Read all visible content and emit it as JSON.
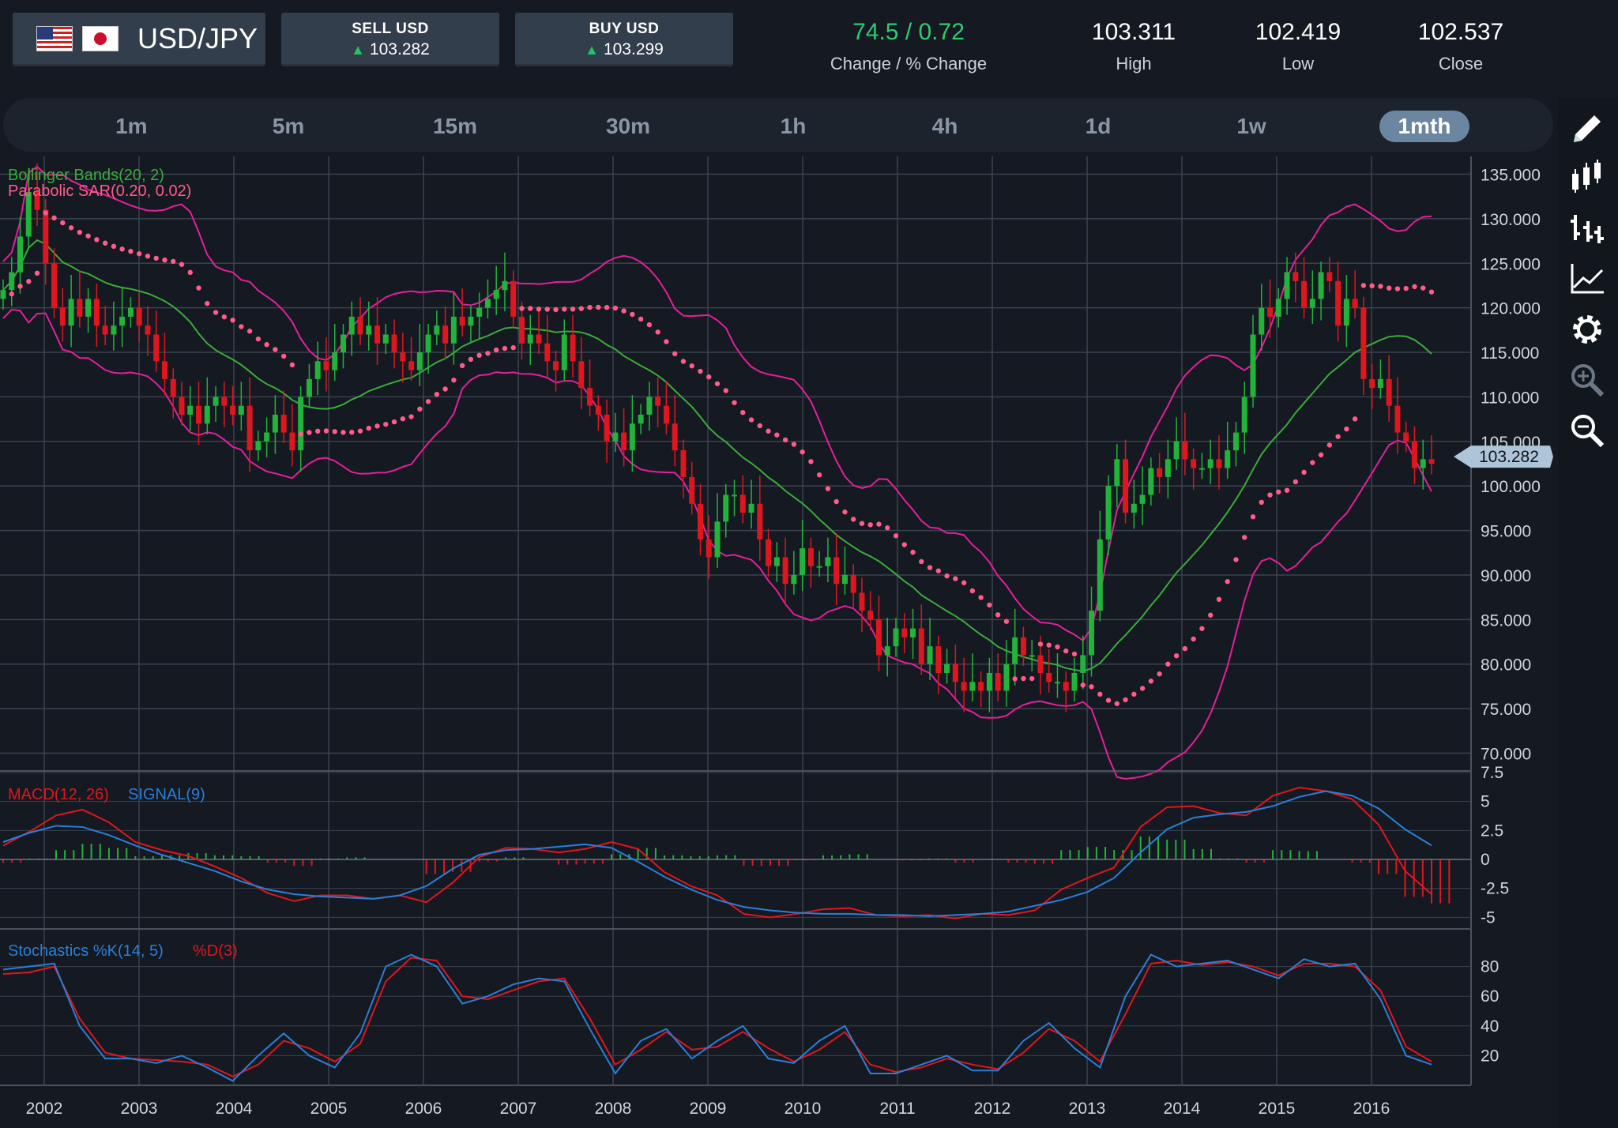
{
  "header": {
    "pair": "USD/JPY",
    "sell_title": "SELL USD",
    "sell_price": "103.282",
    "buy_title": "BUY USD",
    "buy_price": "103.299",
    "change": "74.5 / 0.72",
    "change_label": "Change / % Change",
    "high": "103.311",
    "high_label": "High",
    "low": "102.419",
    "low_label": "Low",
    "close": "102.537",
    "close_label": "Close"
  },
  "timeframes": [
    "1m",
    "5m",
    "15m",
    "30m",
    "1h",
    "4h",
    "1d",
    "1w",
    "1mth"
  ],
  "active_timeframe": "1mth",
  "toolbar_icons": [
    "pencil-icon",
    "candlestick-icon",
    "bars-icon",
    "line-chart-icon",
    "gear-icon",
    "zoom-in-icon",
    "zoom-out-icon"
  ],
  "colors": {
    "bull": "#22b33a",
    "bear": "#e0161e",
    "bollinger_band": "#e51f9c",
    "bollinger_mid": "#3bab3b",
    "sar": "#ff5c8a",
    "macd": "#e0161e",
    "signal": "#2a7fd8",
    "k": "#2a7fd8",
    "d": "#e0161e",
    "price_tag": "#aec4d8",
    "grid": "#3a4350"
  },
  "chart_data": {
    "type": "candlestick",
    "main": {
      "indicator1": "Bollinger Bands(20, 2)",
      "indicator2": "Parabolic SAR(0.20, 0.02)",
      "y_ticks": [
        "135.000",
        "130.000",
        "125.000",
        "120.000",
        "115.000",
        "110.000",
        "105.000",
        "100.000",
        "95.000",
        "90.000",
        "85.000",
        "80.000",
        "75.000",
        "70.000"
      ],
      "ylim": [
        68,
        137
      ],
      "last_price": "103.282",
      "close": [
        122,
        124,
        128,
        133,
        131,
        125,
        120,
        118,
        121,
        119,
        121,
        118,
        117,
        118,
        119,
        120,
        118,
        117,
        114,
        112,
        110,
        108,
        109,
        107,
        109,
        110,
        109,
        108,
        109,
        104,
        105,
        106,
        108,
        106,
        104,
        110,
        112,
        114,
        113,
        115,
        117,
        119,
        117,
        118,
        116,
        117,
        115,
        114,
        113,
        115,
        117,
        118,
        116,
        119,
        118,
        119,
        120,
        121,
        122,
        123,
        119,
        116,
        117,
        116,
        114,
        113,
        117,
        114,
        111,
        109,
        108,
        105,
        106,
        104,
        107,
        108,
        110,
        109,
        107,
        104,
        101,
        98,
        94,
        92,
        96,
        99,
        99,
        97,
        98,
        94,
        91,
        92,
        89,
        90,
        93,
        91,
        91,
        92,
        89,
        90,
        88,
        86,
        85,
        81,
        82,
        84,
        83,
        84,
        80,
        82,
        79,
        80,
        78,
        77,
        78,
        77,
        79,
        77,
        80,
        83,
        81,
        81,
        79,
        78,
        78,
        77,
        79,
        81,
        86,
        94,
        100,
        103,
        97,
        98,
        99,
        102,
        101,
        103,
        105,
        103,
        102,
        102,
        103,
        102,
        104,
        106,
        110,
        117,
        120,
        119,
        121,
        124,
        123,
        120,
        121,
        124,
        123,
        118,
        121,
        120,
        112,
        111,
        112,
        109,
        106,
        105,
        102,
        103,
        102.5
      ]
    },
    "macd": {
      "label": "MACD(12, 26)",
      "signal_label": "SIGNAL(9)",
      "y_ticks": [
        "7.5",
        "5",
        "2.5",
        "0",
        "-2.5",
        "-5"
      ],
      "ylim": [
        -6,
        7.5
      ],
      "macd_values": [
        1.2,
        2.4,
        3.8,
        4.3,
        3.2,
        1.5,
        0.8,
        0.3,
        -0.6,
        -1.6,
        -2.9,
        -3.6,
        -3.1,
        -3.1,
        -3.4,
        -3.1,
        -3.7,
        -2.0,
        0.2,
        1.0,
        0.9,
        0.6,
        0.9,
        1.5,
        0.9,
        -1.1,
        -2.3,
        -3.1,
        -4.7,
        -5.0,
        -4.7,
        -4.3,
        -4.2,
        -4.8,
        -4.9,
        -4.8,
        -5.1,
        -4.7,
        -4.8,
        -4.4,
        -2.6,
        -1.6,
        -0.7,
        2.8,
        4.5,
        4.6,
        4.0,
        3.8,
        5.5,
        6.2,
        5.9,
        5.2,
        3.0,
        -1.0,
        -3.0
      ],
      "signal_values": [
        1.5,
        2.3,
        2.9,
        2.8,
        2.1,
        1.2,
        0.4,
        -0.3,
        -1.0,
        -1.9,
        -2.6,
        -3.0,
        -3.2,
        -3.3,
        -3.4,
        -3.1,
        -2.3,
        -0.8,
        0.4,
        0.8,
        0.9,
        1.1,
        1.3,
        1.0,
        -0.2,
        -1.5,
        -2.6,
        -3.5,
        -4.1,
        -4.4,
        -4.6,
        -4.7,
        -4.7,
        -4.8,
        -4.8,
        -4.9,
        -4.8,
        -4.7,
        -4.5,
        -4.0,
        -3.5,
        -2.8,
        -1.6,
        0.6,
        2.6,
        3.6,
        3.9,
        4.1,
        4.6,
        5.4,
        5.9,
        5.5,
        4.4,
        2.6,
        1.2
      ]
    },
    "stochastics": {
      "label": "Stochastics %K(14, 5)",
      "d_label": "%D(3)",
      "y_ticks": [
        "80",
        "60",
        "40",
        "20"
      ],
      "ylim": [
        0,
        100
      ],
      "k_values": [
        78,
        80,
        82,
        40,
        18,
        18,
        15,
        20,
        12,
        3,
        20,
        35,
        20,
        12,
        35,
        80,
        88,
        80,
        55,
        60,
        68,
        72,
        70,
        38,
        8,
        30,
        38,
        18,
        30,
        40,
        18,
        15,
        30,
        40,
        8,
        8,
        14,
        20,
        10,
        10,
        30,
        42,
        25,
        12,
        60,
        88,
        80,
        82,
        84,
        78,
        72,
        85,
        80,
        82,
        58,
        20,
        14
      ],
      "d_values": [
        75,
        76,
        80,
        45,
        22,
        18,
        17,
        16,
        14,
        6,
        14,
        30,
        25,
        16,
        28,
        70,
        86,
        84,
        60,
        58,
        64,
        70,
        72,
        45,
        14,
        24,
        36,
        24,
        26,
        36,
        25,
        16,
        24,
        36,
        14,
        9,
        12,
        18,
        14,
        11,
        22,
        38,
        30,
        16,
        48,
        82,
        84,
        81,
        83,
        80,
        74,
        82,
        82,
        80,
        64,
        26,
        16
      ]
    },
    "x_labels": [
      "2002",
      "2003",
      "2004",
      "2005",
      "2006",
      "2007",
      "2008",
      "2009",
      "2010",
      "2011",
      "2012",
      "2013",
      "2014",
      "2015",
      "2016"
    ]
  }
}
